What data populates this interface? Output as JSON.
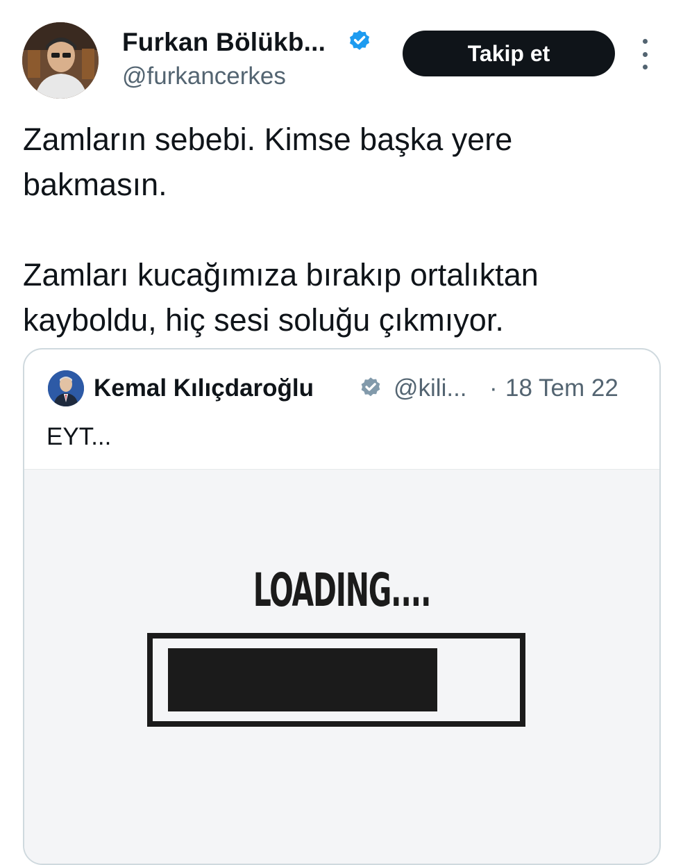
{
  "author": {
    "display_name": "Furkan Bölükb...",
    "handle": "@furkancerkes",
    "verified_icon": "verified-badge-icon",
    "verified_color": "#1d9bf0"
  },
  "actions": {
    "follow_label": "Takip et",
    "more_icon": "more-vertical-icon"
  },
  "tweet": {
    "lines": [
      "Zamların sebebi. Kimse başka yere",
      "bakmasın.",
      "Zamları kucağımıza bırakıp ortalıktan",
      "kayboldu, hiç sesi soluğu çıkmıyor."
    ]
  },
  "quoted_tweet": {
    "display_name": "Kemal Kılıçdaroğlu",
    "handle": "@kili...",
    "separator": "·",
    "date": "18 Tem 22",
    "verified_icon": "verified-badge-icon",
    "verified_color": "#829aab",
    "text": "EYT...",
    "media": {
      "caption": "LOADING....",
      "progress_fraction": 0.8
    }
  },
  "colors": {
    "text_primary": "#0f1419",
    "text_secondary": "#536471",
    "button_bg": "#0f1419",
    "card_border": "#cfd9de"
  }
}
